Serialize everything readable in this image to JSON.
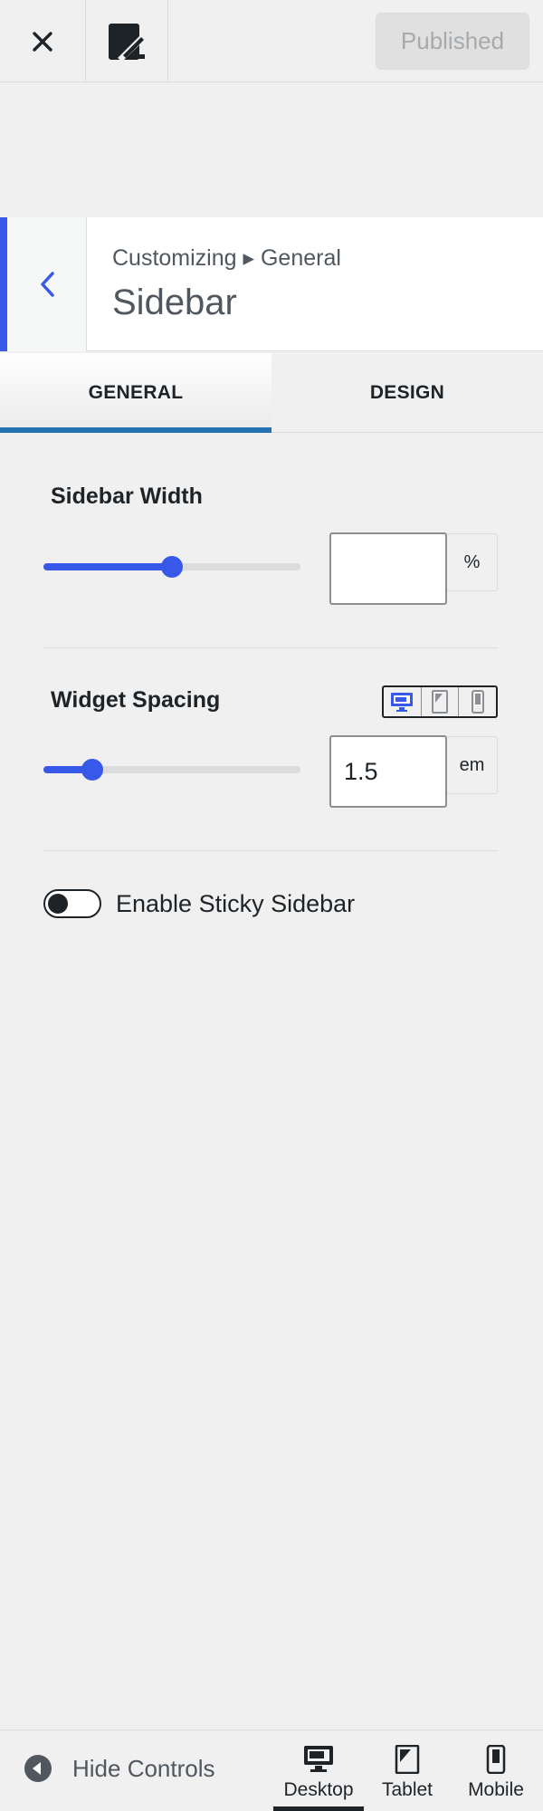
{
  "header": {
    "close_icon": "close-icon",
    "customize_icon": "paintbrush-icon",
    "publish_label": "Published"
  },
  "section": {
    "breadcrumb": "Customizing ▸ General",
    "title": "Sidebar",
    "back_icon": "chevron-left-icon"
  },
  "tabs": [
    {
      "label": "GENERAL",
      "active": true
    },
    {
      "label": "DESIGN",
      "active": false
    }
  ],
  "controls": {
    "sidebar_width": {
      "label": "Sidebar Width",
      "value": "",
      "unit": "%",
      "slider_fraction": 0.5
    },
    "widget_spacing": {
      "label": "Widget Spacing",
      "value": "1.5",
      "unit": "em",
      "slider_fraction": 0.19,
      "devices": [
        "desktop-icon",
        "tablet-icon",
        "mobile-icon"
      ],
      "active_device": "desktop"
    },
    "sticky_sidebar": {
      "label": "Enable Sticky Sidebar",
      "enabled": false
    }
  },
  "footer": {
    "hide_controls_label": "Hide Controls",
    "devices": [
      {
        "label": "Desktop",
        "icon": "desktop-icon",
        "active": true
      },
      {
        "label": "Tablet",
        "icon": "tablet-icon",
        "active": false
      },
      {
        "label": "Mobile",
        "icon": "mobile-icon",
        "active": false
      }
    ]
  },
  "colors": {
    "accent": "#3858e9",
    "tab_underline": "#2271b1",
    "text": "#1d2327",
    "muted": "#50575e"
  }
}
